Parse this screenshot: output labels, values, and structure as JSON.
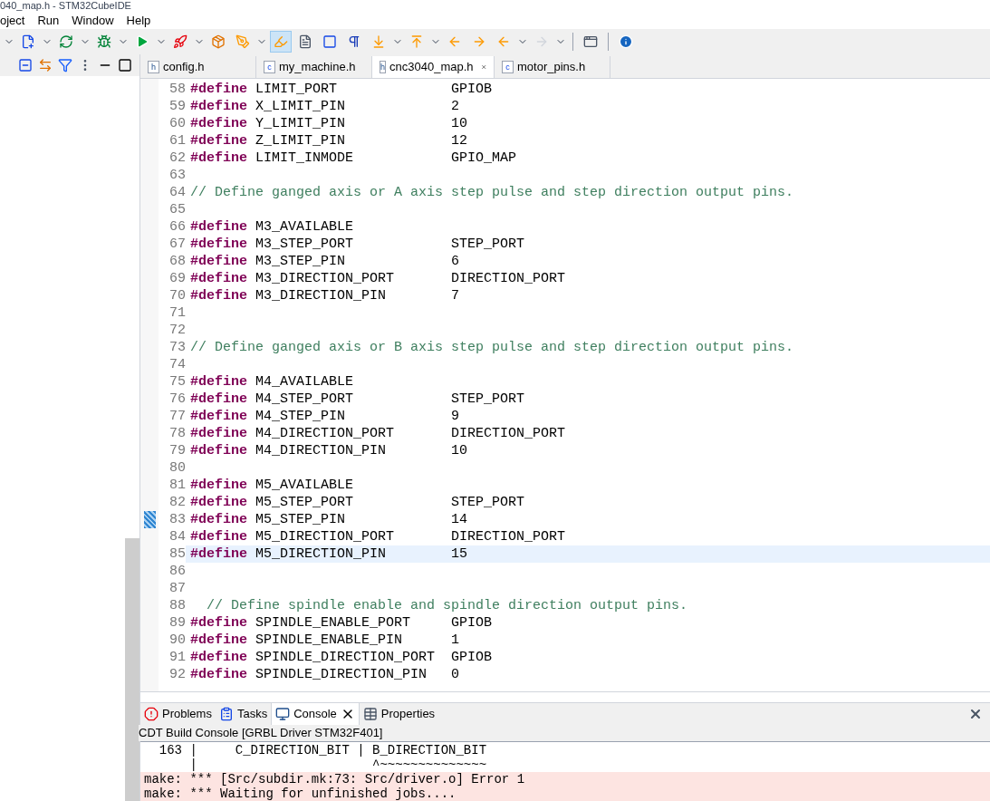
{
  "window": {
    "title": "040_map.h - STM32CubeIDE"
  },
  "menu": [
    {
      "label": "oject"
    },
    {
      "label": "Run"
    },
    {
      "label": "Window"
    },
    {
      "label": "Help"
    }
  ],
  "editor_tabs": [
    {
      "label": "config.h",
      "file_type": "h",
      "selected": false
    },
    {
      "label": "my_machine.h",
      "file_type": "c",
      "selected": false
    },
    {
      "label": "cnc3040_map.h",
      "file_type": "h",
      "selected": true
    },
    {
      "label": "motor_pins.h",
      "file_type": "c",
      "selected": false
    }
  ],
  "code_lines": [
    {
      "number": "58",
      "kind": "define",
      "keyword": "#define",
      "name": "LIMIT_PORT",
      "value": "GPIOB",
      "current": false,
      "marked": false
    },
    {
      "number": "59",
      "kind": "define",
      "keyword": "#define",
      "name": "X_LIMIT_PIN",
      "value": "2",
      "current": false,
      "marked": false
    },
    {
      "number": "60",
      "kind": "define",
      "keyword": "#define",
      "name": "Y_LIMIT_PIN",
      "value": "10",
      "current": false,
      "marked": false
    },
    {
      "number": "61",
      "kind": "define",
      "keyword": "#define",
      "name": "Z_LIMIT_PIN",
      "value": "12",
      "current": false,
      "marked": false
    },
    {
      "number": "62",
      "kind": "define",
      "keyword": "#define",
      "name": "LIMIT_INMODE",
      "value": "GPIO_MAP",
      "current": false,
      "marked": false
    },
    {
      "number": "63",
      "kind": "blank",
      "current": false,
      "marked": false
    },
    {
      "number": "64",
      "kind": "comment",
      "text": "// Define ganged axis or A axis step pulse and step direction output pins.",
      "indent": false,
      "current": false,
      "marked": false
    },
    {
      "number": "65",
      "kind": "blank",
      "current": false,
      "marked": false
    },
    {
      "number": "66",
      "kind": "define",
      "keyword": "#define",
      "name": "M3_AVAILABLE",
      "current": false,
      "marked": false
    },
    {
      "number": "67",
      "kind": "define",
      "keyword": "#define",
      "name": "M3_STEP_PORT",
      "value": "STEP_PORT",
      "current": false,
      "marked": false
    },
    {
      "number": "68",
      "kind": "define",
      "keyword": "#define",
      "name": "M3_STEP_PIN",
      "value": "6",
      "current": false,
      "marked": false
    },
    {
      "number": "69",
      "kind": "define",
      "keyword": "#define",
      "name": "M3_DIRECTION_PORT",
      "value": "DIRECTION_PORT",
      "current": false,
      "marked": false
    },
    {
      "number": "70",
      "kind": "define",
      "keyword": "#define",
      "name": "M3_DIRECTION_PIN",
      "value": "7",
      "current": false,
      "marked": false
    },
    {
      "number": "71",
      "kind": "blank",
      "current": false,
      "marked": false
    },
    {
      "number": "72",
      "kind": "blank",
      "current": false,
      "marked": false
    },
    {
      "number": "73",
      "kind": "comment",
      "text": "// Define ganged axis or B axis step pulse and step direction output pins.",
      "indent": false,
      "current": false,
      "marked": false
    },
    {
      "number": "74",
      "kind": "blank",
      "current": false,
      "marked": false
    },
    {
      "number": "75",
      "kind": "define",
      "keyword": "#define",
      "name": "M4_AVAILABLE",
      "current": false,
      "marked": false
    },
    {
      "number": "76",
      "kind": "define",
      "keyword": "#define",
      "name": "M4_STEP_PORT",
      "value": "STEP_PORT",
      "current": false,
      "marked": false
    },
    {
      "number": "77",
      "kind": "define",
      "keyword": "#define",
      "name": "M4_STEP_PIN",
      "value": "9",
      "current": false,
      "marked": false
    },
    {
      "number": "78",
      "kind": "define",
      "keyword": "#define",
      "name": "M4_DIRECTION_PORT",
      "value": "DIRECTION_PORT",
      "current": false,
      "marked": false
    },
    {
      "number": "79",
      "kind": "define",
      "keyword": "#define",
      "name": "M4_DIRECTION_PIN",
      "value": "10",
      "current": false,
      "marked": false
    },
    {
      "number": "80",
      "kind": "blank",
      "current": false,
      "marked": false
    },
    {
      "number": "81",
      "kind": "define",
      "keyword": "#define",
      "name": "M5_AVAILABLE",
      "current": false,
      "marked": false
    },
    {
      "number": "82",
      "kind": "define",
      "keyword": "#define",
      "name": "M5_STEP_PORT",
      "value": "STEP_PORT",
      "current": false,
      "marked": false
    },
    {
      "number": "83",
      "kind": "define",
      "keyword": "#define",
      "name": "M5_STEP_PIN",
      "value": "14",
      "current": false,
      "marked": true
    },
    {
      "number": "84",
      "kind": "define",
      "keyword": "#define",
      "name": "M5_DIRECTION_PORT",
      "value": "DIRECTION_PORT",
      "current": false,
      "marked": false
    },
    {
      "number": "85",
      "kind": "define",
      "keyword": "#define",
      "name": "M5_DIRECTION_PIN",
      "value": "15",
      "current": true,
      "marked": false
    },
    {
      "number": "86",
      "kind": "blank",
      "current": false,
      "marked": false
    },
    {
      "number": "87",
      "kind": "blank",
      "current": false,
      "marked": false
    },
    {
      "number": "88",
      "kind": "comment",
      "text": "// Define spindle enable and spindle direction output pins.",
      "indent": true,
      "current": false,
      "marked": false
    },
    {
      "number": "89",
      "kind": "define",
      "keyword": "#define",
      "name": "SPINDLE_ENABLE_PORT",
      "value": "GPIOB",
      "current": false,
      "marked": false
    },
    {
      "number": "90",
      "kind": "define",
      "keyword": "#define",
      "name": "SPINDLE_ENABLE_PIN",
      "value": "1",
      "current": false,
      "marked": false
    },
    {
      "number": "91",
      "kind": "define",
      "keyword": "#define",
      "name": "SPINDLE_DIRECTION_PORT",
      "value": "GPIOB",
      "current": false,
      "marked": false
    },
    {
      "number": "92",
      "kind": "define",
      "keyword": "#define",
      "name": "SPINDLE_DIRECTION_PIN",
      "value": "0",
      "current": false,
      "marked": false
    }
  ],
  "bottom_tabs": [
    {
      "label": "Problems",
      "selected": false
    },
    {
      "label": "Tasks",
      "selected": false
    },
    {
      "label": "Console",
      "selected": true
    },
    {
      "label": "Properties",
      "selected": false
    }
  ],
  "console": {
    "title": "CDT Build Console [GRBL Driver STM32F401]",
    "lines": [
      {
        "text": "  163 |     C_DIRECTION_BIT | B_DIRECTION_BIT",
        "kind": "output"
      },
      {
        "text": "      |                       ^~~~~~~~~~~~~~~",
        "kind": "output"
      },
      {
        "text": "make: *** [Src/subdir.mk:73: Src/driver.o] Error 1",
        "kind": "error"
      },
      {
        "text": "make: *** Waiting for unfinished jobs....",
        "kind": "error"
      }
    ]
  }
}
